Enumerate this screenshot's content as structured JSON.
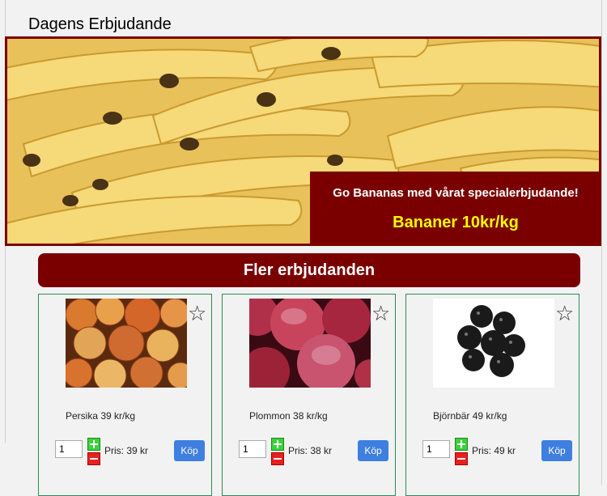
{
  "page": {
    "title": "Dagens Erbjudande"
  },
  "banner": {
    "image": "bananas-photo",
    "promo_text": "Go Bananas med vårat specialerbjudande!",
    "promo_price": "Bananer 10kr/kg",
    "colors": {
      "box": "#7a0000",
      "price": "#ffff00"
    }
  },
  "more": {
    "title": "Fler erbjudanden"
  },
  "products": [
    {
      "name": "Persika  39 kr/kg",
      "qty": "1",
      "price": "Pris: 39 kr",
      "buy": "Köp",
      "image": "peaches-photo",
      "favorite_icon": "star-icon"
    },
    {
      "name": "Plommon  38 kr/kg",
      "qty": "1",
      "price": "Pris: 38 kr",
      "buy": "Köp",
      "image": "plums-photo",
      "favorite_icon": "star-icon"
    },
    {
      "name": "Björnbär  49 kr/kg",
      "qty": "1",
      "price": "Pris: 49 kr",
      "buy": "Köp",
      "image": "blackberries-photo",
      "favorite_icon": "star-icon"
    }
  ],
  "colors": {
    "accent": "#7a0000",
    "buy_button": "#3e7fe0",
    "card_border": "#2e8b57"
  }
}
